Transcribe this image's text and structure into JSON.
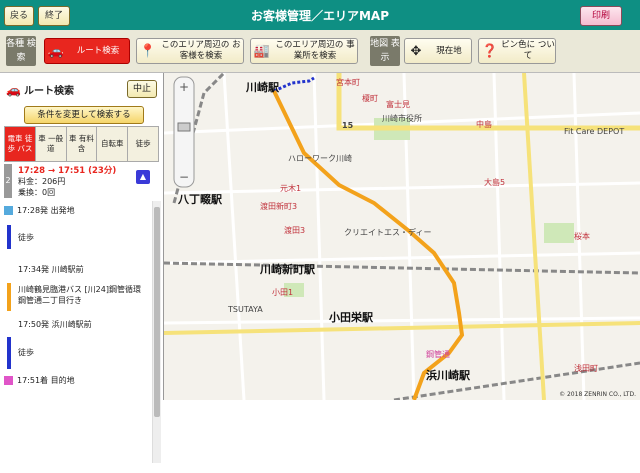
{
  "header": {
    "back_label": "戻る",
    "exit_label": "終了",
    "title": "お客様管理／エリアMAP",
    "print_label": "印刷"
  },
  "toolbar": {
    "group1_label": "各種 検索",
    "route_search": "ルート検索",
    "area_customers": "このエリア周辺の お客様を検索",
    "area_offices": "このエリア周辺の 事業所を検索",
    "group2_label": "地図 表示",
    "current_location": "現在地",
    "pin_color": "ピン色に ついて"
  },
  "sidebar": {
    "title": "ルート検索",
    "stop_label": "中止",
    "change_cond_label": "条件を変更して検索する",
    "modes": [
      "電車 徒歩 バス",
      "車 一般道",
      "車 有料含",
      "自転車",
      "徒歩"
    ],
    "summary": {
      "number": "2",
      "time": "17:28 → 17:51 (23分)",
      "fare": "料金：206円",
      "transfers": "乗換：0回"
    },
    "steps": [
      {
        "text": "17:28発 出発地",
        "type": "start"
      },
      {
        "text": "徒歩",
        "type": "walk"
      },
      {
        "text": "17:34発 川崎駅前",
        "type": "stop"
      },
      {
        "text": "川崎鶴見臨港バス [川24]鋼管循環 鋼管通二丁目行き",
        "type": "bus"
      },
      {
        "text": "17:50発 浜川崎駅前",
        "type": "stop"
      },
      {
        "text": "徒歩",
        "type": "walk"
      },
      {
        "text": "17:51着 目的地",
        "type": "end"
      }
    ]
  },
  "map": {
    "labels": {
      "kawasaki_st": "川崎駅",
      "hatchobori_st": "八丁畷駅",
      "kawasakishinmachi_st": "川崎新町駅",
      "odasakae_st": "小田栄駅",
      "hamakawasaki_st": "浜川崎駅",
      "miyamoto": "宮本町",
      "fujimi": "富士見",
      "enoki": "榎町",
      "nakajima": "中島",
      "ohshima5": "大島5",
      "watarida3": "渡田3",
      "watarida_shinmachi3": "渡田新町3",
      "motoki": "元木1",
      "oda1": "小田1",
      "sakuramoto": "桜本",
      "asada": "浅田町",
      "fit_care": "Fit Care DEPOT",
      "route15": "15",
      "kokan": "鋼管通",
      "kawasaki_city_hall": "川崎市役所",
      "hello_work": "ハローワーク川崎",
      "creates": "クリエイトエス・ディー",
      "tsutaya": "TSUTAYA"
    },
    "copyright": "© 2018 ZENRIN CO., LTD."
  },
  "colors": {
    "header_bg": "#0e8f83",
    "active_red": "#e8261f",
    "route_orange": "#f3a21b",
    "walk_blue": "#2233cc"
  }
}
